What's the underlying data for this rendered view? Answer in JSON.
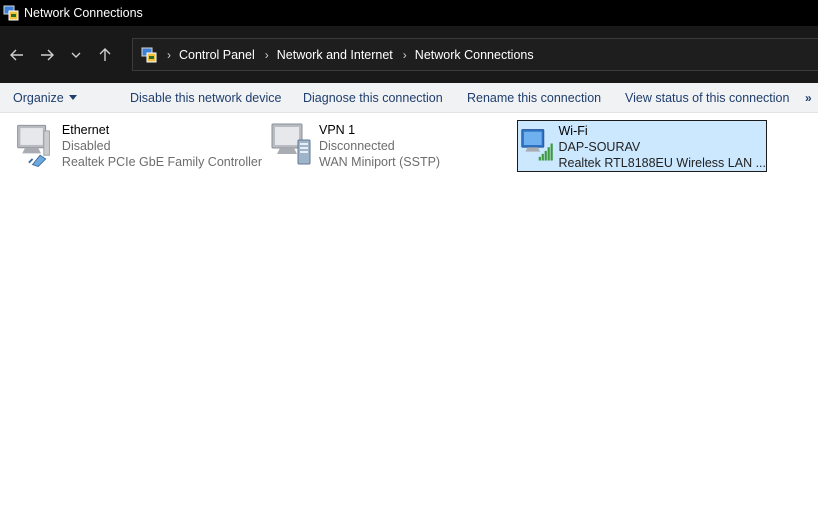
{
  "window": {
    "title": "Network Connections"
  },
  "breadcrumb": [
    "Control Panel",
    "Network and Internet",
    "Network Connections"
  ],
  "command_bar": {
    "organize": "Organize",
    "disable": "Disable this network device",
    "diagnose": "Diagnose this connection",
    "rename": "Rename this connection",
    "view_status": "View status of this connection",
    "more": "»"
  },
  "connections": [
    {
      "name": "Ethernet",
      "status": "Disabled",
      "device": "Realtek PCIe GbE Family Controller",
      "icon": "ethernet-adapter-icon"
    },
    {
      "name": "VPN 1",
      "status": "Disconnected",
      "device": "WAN Miniport (SSTP)",
      "icon": "vpn-adapter-icon"
    },
    {
      "name": "Wi-Fi",
      "status": "DAP-SOURAV",
      "device": "Realtek RTL8188EU Wireless LAN ...",
      "icon": "wifi-adapter-icon",
      "selected": true
    }
  ],
  "colors": {
    "titlebar": "#000000",
    "navbar": "#191919",
    "cmdbar": "#f1f2f4",
    "command_text": "#1f3e6e",
    "selection": "#cce8ff"
  }
}
